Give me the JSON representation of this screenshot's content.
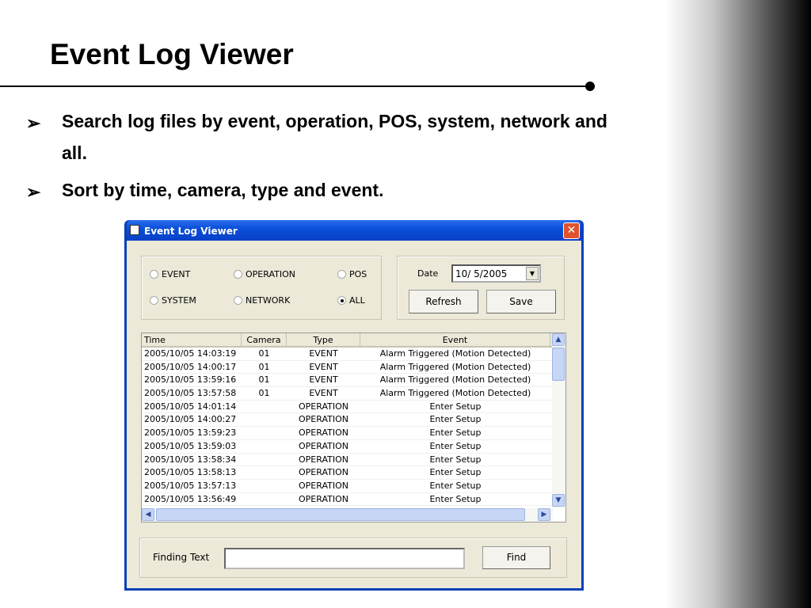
{
  "slide": {
    "title": "Event Log Viewer",
    "bullet_glyph": "➢",
    "bullets": [
      "Search log files by event, operation, POS, system, network and all.",
      "Sort by time, camera, type and event."
    ]
  },
  "window": {
    "title": "Event Log Viewer",
    "close": "✕"
  },
  "filters": [
    {
      "label": "EVENT",
      "checked": false
    },
    {
      "label": "OPERATION",
      "checked": false
    },
    {
      "label": "POS",
      "checked": false
    },
    {
      "label": "SYSTEM",
      "checked": false
    },
    {
      "label": "NETWORK",
      "checked": false
    },
    {
      "label": "ALL",
      "checked": true
    }
  ],
  "date": {
    "label": "Date",
    "value": "10/ 5/2005"
  },
  "buttons": {
    "refresh": "Refresh",
    "save": "Save",
    "find": "Find"
  },
  "table": {
    "headers": [
      "Time",
      "Camera",
      "Type",
      "Event"
    ],
    "rows": [
      [
        "2005/10/05 14:03:19",
        "01",
        "EVENT",
        "Alarm Triggered (Motion Detected)"
      ],
      [
        "2005/10/05 14:00:17",
        "01",
        "EVENT",
        "Alarm Triggered (Motion Detected)"
      ],
      [
        "2005/10/05 13:59:16",
        "01",
        "EVENT",
        "Alarm Triggered (Motion Detected)"
      ],
      [
        "2005/10/05 13:57:58",
        "01",
        "EVENT",
        "Alarm Triggered (Motion Detected)"
      ],
      [
        "2005/10/05 14:01:14",
        "",
        "OPERATION",
        "Enter Setup"
      ],
      [
        "2005/10/05 14:00:27",
        "",
        "OPERATION",
        "Enter Setup"
      ],
      [
        "2005/10/05 13:59:23",
        "",
        "OPERATION",
        "Enter Setup"
      ],
      [
        "2005/10/05 13:59:03",
        "",
        "OPERATION",
        "Enter Setup"
      ],
      [
        "2005/10/05 13:58:34",
        "",
        "OPERATION",
        "Enter Setup"
      ],
      [
        "2005/10/05 13:58:13",
        "",
        "OPERATION",
        "Enter Setup"
      ],
      [
        "2005/10/05 13:57:13",
        "",
        "OPERATION",
        "Enter Setup"
      ],
      [
        "2005/10/05 13:56:49",
        "",
        "OPERATION",
        "Enter Setup"
      ]
    ]
  },
  "find": {
    "label": "Finding Text",
    "value": ""
  }
}
